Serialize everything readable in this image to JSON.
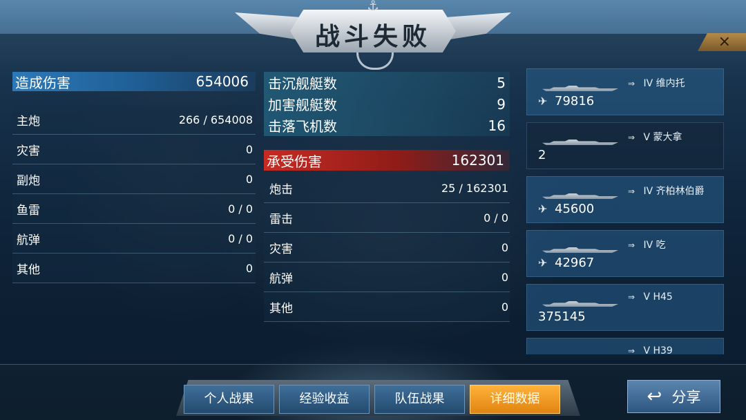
{
  "title": "战斗失败",
  "close_icon": "×",
  "damage_dealt": {
    "label": "造成伤害",
    "value": "654006",
    "rows": [
      {
        "label": "主炮",
        "value": "266 / 654008"
      },
      {
        "label": "灾害",
        "value": "0"
      },
      {
        "label": "副炮",
        "value": "0"
      },
      {
        "label": "鱼雷",
        "value": "0 / 0"
      },
      {
        "label": "航弹",
        "value": "0 / 0"
      },
      {
        "label": "其他",
        "value": "0"
      }
    ]
  },
  "kills": [
    {
      "label": "击沉舰艇数",
      "value": "5"
    },
    {
      "label": "加害舰艇数",
      "value": "9"
    },
    {
      "label": "击落飞机数",
      "value": "16"
    }
  ],
  "damage_taken": {
    "label": "承受伤害",
    "value": "162301",
    "rows": [
      {
        "label": "炮击",
        "value": "25 / 162301"
      },
      {
        "label": "雷击",
        "value": "0 / 0"
      },
      {
        "label": "灾害",
        "value": "0"
      },
      {
        "label": "航弹",
        "value": "0"
      },
      {
        "label": "其他",
        "value": "0"
      }
    ]
  },
  "ships": [
    {
      "tier": "IV",
      "name": "维内托",
      "value": "79816",
      "icon": "plane-icon",
      "arrow": "arrow-icon"
    },
    {
      "tier": "V",
      "name": "蒙大拿",
      "value": "2",
      "icon": "",
      "arrow": "arrow-icon"
    },
    {
      "tier": "IV",
      "name": "齐柏林伯爵",
      "value": "45600",
      "icon": "plane-icon",
      "arrow": "arrow-icon"
    },
    {
      "tier": "IV",
      "name": "吃",
      "value": "42967",
      "icon": "plane-icon",
      "arrow": "arrow-icon"
    },
    {
      "tier": "V",
      "name": "H45",
      "value": "375145",
      "icon": "",
      "arrow": "arrow-icon"
    },
    {
      "tier": "V",
      "name": "H39",
      "value": "",
      "icon": "",
      "arrow": "arrow-icon"
    }
  ],
  "tabs": [
    {
      "label": "个人战果"
    },
    {
      "label": "经验收益"
    },
    {
      "label": "队伍战果"
    },
    {
      "label": "详细数据"
    }
  ],
  "share_label": "分享",
  "colors": {
    "accent_orange": "#f59a1f",
    "header_blue": "#2d79b8",
    "header_red": "#c72b22"
  }
}
